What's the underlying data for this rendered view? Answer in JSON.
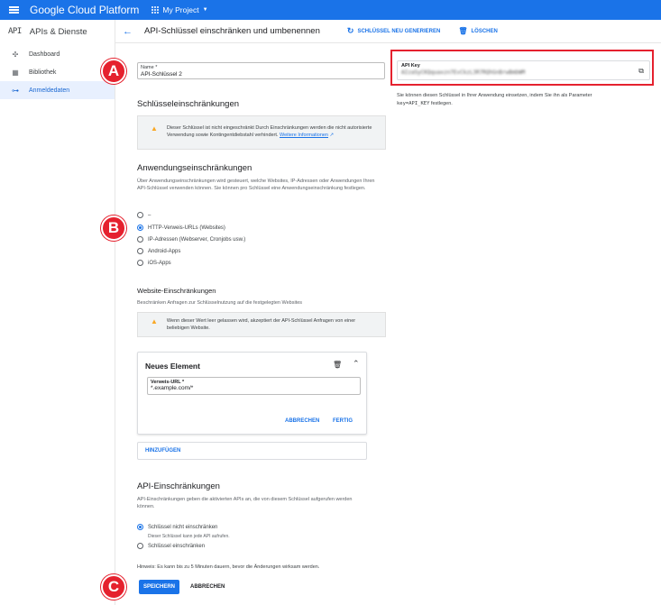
{
  "topbar": {
    "brand": "Google Cloud Platform",
    "project": "My Project"
  },
  "sidebar": {
    "badge": "API",
    "title": "APIs & Dienste",
    "items": [
      {
        "label": "Dashboard",
        "icon": "dashboard-icon"
      },
      {
        "label": "Bibliothek",
        "icon": "library-icon"
      },
      {
        "label": "Anmeldedaten",
        "icon": "key-icon",
        "active": true
      }
    ]
  },
  "header": {
    "title": "API-Schlüssel einschränken und umbenennen",
    "regenerate": "SCHLÜSSEL NEU GENERIEREN",
    "delete": "LÖSCHEN"
  },
  "name_field": {
    "label": "Name *",
    "value": "API-Schlüssel 2"
  },
  "api_key": {
    "label": "API Key",
    "value": "AIzaSyCKQquaxzn7EvCkzL3R7RQhGnBrwBmbWM",
    "help": "Sie können diesen Schlüssel in Ihrer Anwendung einsetzen, indem Sie ihn als Parameter",
    "help_param": "key=API_KEY",
    "help_end": "festlegen."
  },
  "key_restrictions": {
    "heading": "Schlüsseleinschränkungen",
    "warning": "Dieser Schlüssel ist nicht eingeschränkt Durch Einschränkungen werden die nicht autorisierte Verwendung sowie Kontingentdiebstahl verhindert.",
    "link": "Weitere Informationen"
  },
  "app_restrictions": {
    "heading": "Anwendungseinschränkungen",
    "desc": "Über Anwendungseinschränkungen wird gesteuert, welche Websites, IP-Adressen oder Anwendungen Ihren API-Schlüssel verwenden können. Sie können pro Schlüssel eine Anwendungseinschränkung festlegen.",
    "options": [
      "–",
      "HTTP-Verweis-URLs (Websites)",
      "IP-Adressen (Webserver, Cronjobs usw.)",
      "Android-Apps",
      "iOS-Apps"
    ],
    "selected": 1
  },
  "website": {
    "heading": "Website-Einschränkungen",
    "desc": "Beschränken Anfragen zur Schlüsselnutzung auf die festgelegten Websites",
    "warning": "Wenn dieser Wert leer gelassen wird, akzeptiert der API-Schlüssel Anfragen von einer beliebigen Website."
  },
  "new_item": {
    "title": "Neues Element",
    "field_label": "Verweis-URL *",
    "field_value": "*.example.com/*",
    "cancel": "ABBRECHEN",
    "done": "FERTIG"
  },
  "add_button": "HINZUFÜGEN",
  "api_restrictions": {
    "heading": "API-Einschränkungen",
    "desc": "API-Einschränkungen geben die aktivierten APIs an, die von diesem Schlüssel aufgerufen werden können.",
    "option1": "Schlüssel nicht einschränken",
    "option1_sub": "Dieser Schlüssel kann jede API aufrufen.",
    "option2": "Schlüssel einschränken",
    "hint": "Hinweis: Es kann bis zu 5 Minuten dauern, bevor die Änderungen wirksam werden."
  },
  "footer": {
    "save": "SPEICHERN",
    "cancel": "ABBRECHEN"
  },
  "markers": {
    "a": "A",
    "b": "B",
    "c": "C"
  },
  "colors": {
    "accent": "#1a73e8",
    "marker": "#e5212e",
    "warning": "#f9a825"
  }
}
